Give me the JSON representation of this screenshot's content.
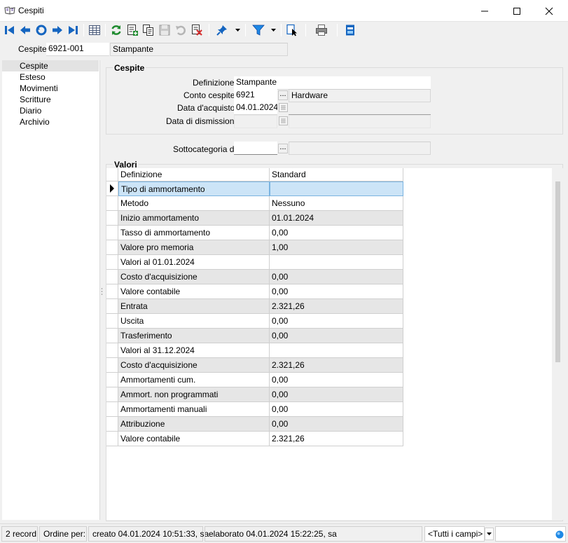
{
  "window": {
    "title": "Cespiti"
  },
  "header": {
    "label": "Cespite",
    "code": "6921-001",
    "name": "Stampante"
  },
  "nav": {
    "items": [
      {
        "label": "Cespite",
        "selected": true
      },
      {
        "label": "Esteso"
      },
      {
        "label": "Movimenti"
      },
      {
        "label": "Scritture"
      },
      {
        "label": "Diario"
      },
      {
        "label": "Archivio"
      }
    ]
  },
  "cespite_group": {
    "title": "Cespite",
    "definizione_label": "Definizione",
    "definizione": "Stampante",
    "conto_label": "Conto cespite",
    "conto_code": "6921",
    "conto_button": "...",
    "conto_name": "Hardware",
    "acquisto_label": "Data d'acquisto",
    "acquisto": "04.01.2024",
    "dismissione_label": "Data di dismissione",
    "dismissione": ""
  },
  "sottocategoria": {
    "label": "Sottocategoria di",
    "value": "",
    "button": "..."
  },
  "valori": {
    "title": "Valori",
    "columns": [
      "Definizione",
      "Standard"
    ],
    "rows": [
      {
        "def": "Tipo di ammortamento",
        "val": "",
        "current": true
      },
      {
        "def": "Metodo",
        "val": "Nessuno"
      },
      {
        "def": "Inizio ammortamento",
        "val": "01.01.2024"
      },
      {
        "def": "Tasso di ammortamento",
        "val": "0,00"
      },
      {
        "def": "Valore pro memoria",
        "val": "1,00"
      },
      {
        "def": "Valori al 01.01.2024",
        "val": ""
      },
      {
        "def": "Costo d'acquisizione",
        "val": "0,00"
      },
      {
        "def": "Valore contabile",
        "val": "0,00"
      },
      {
        "def": "Entrata",
        "val": "2.321,26"
      },
      {
        "def": "Uscita",
        "val": "0,00"
      },
      {
        "def": "Trasferimento",
        "val": "0,00"
      },
      {
        "def": "Valori al 31.12.2024",
        "val": ""
      },
      {
        "def": "Costo d'acquisizione",
        "val": "2.321,26"
      },
      {
        "def": "Ammortamenti cum.",
        "val": "0,00"
      },
      {
        "def": "Ammort. non programmati",
        "val": "0,00"
      },
      {
        "def": "Ammortamenti manuali",
        "val": "0,00"
      },
      {
        "def": "Attribuzione",
        "val": "0,00"
      },
      {
        "def": "Valore contabile",
        "val": "2.321,26"
      }
    ]
  },
  "status": {
    "records": "2 record",
    "ordine": "Ordine per:",
    "creato": "creato 04.01.2024 10:51:33, sa",
    "elaborato": "elaborato 04.01.2024 15:22:25, sa",
    "campi": "<Tutti i campi>",
    "search": ""
  },
  "colors": {
    "toolbar_blue": "#1565c0",
    "selected_row": "#cce4f7",
    "alt_row": "#e6e6e6",
    "refresh_green": "#1e8a2e",
    "delete_red": "#d32f2f"
  }
}
